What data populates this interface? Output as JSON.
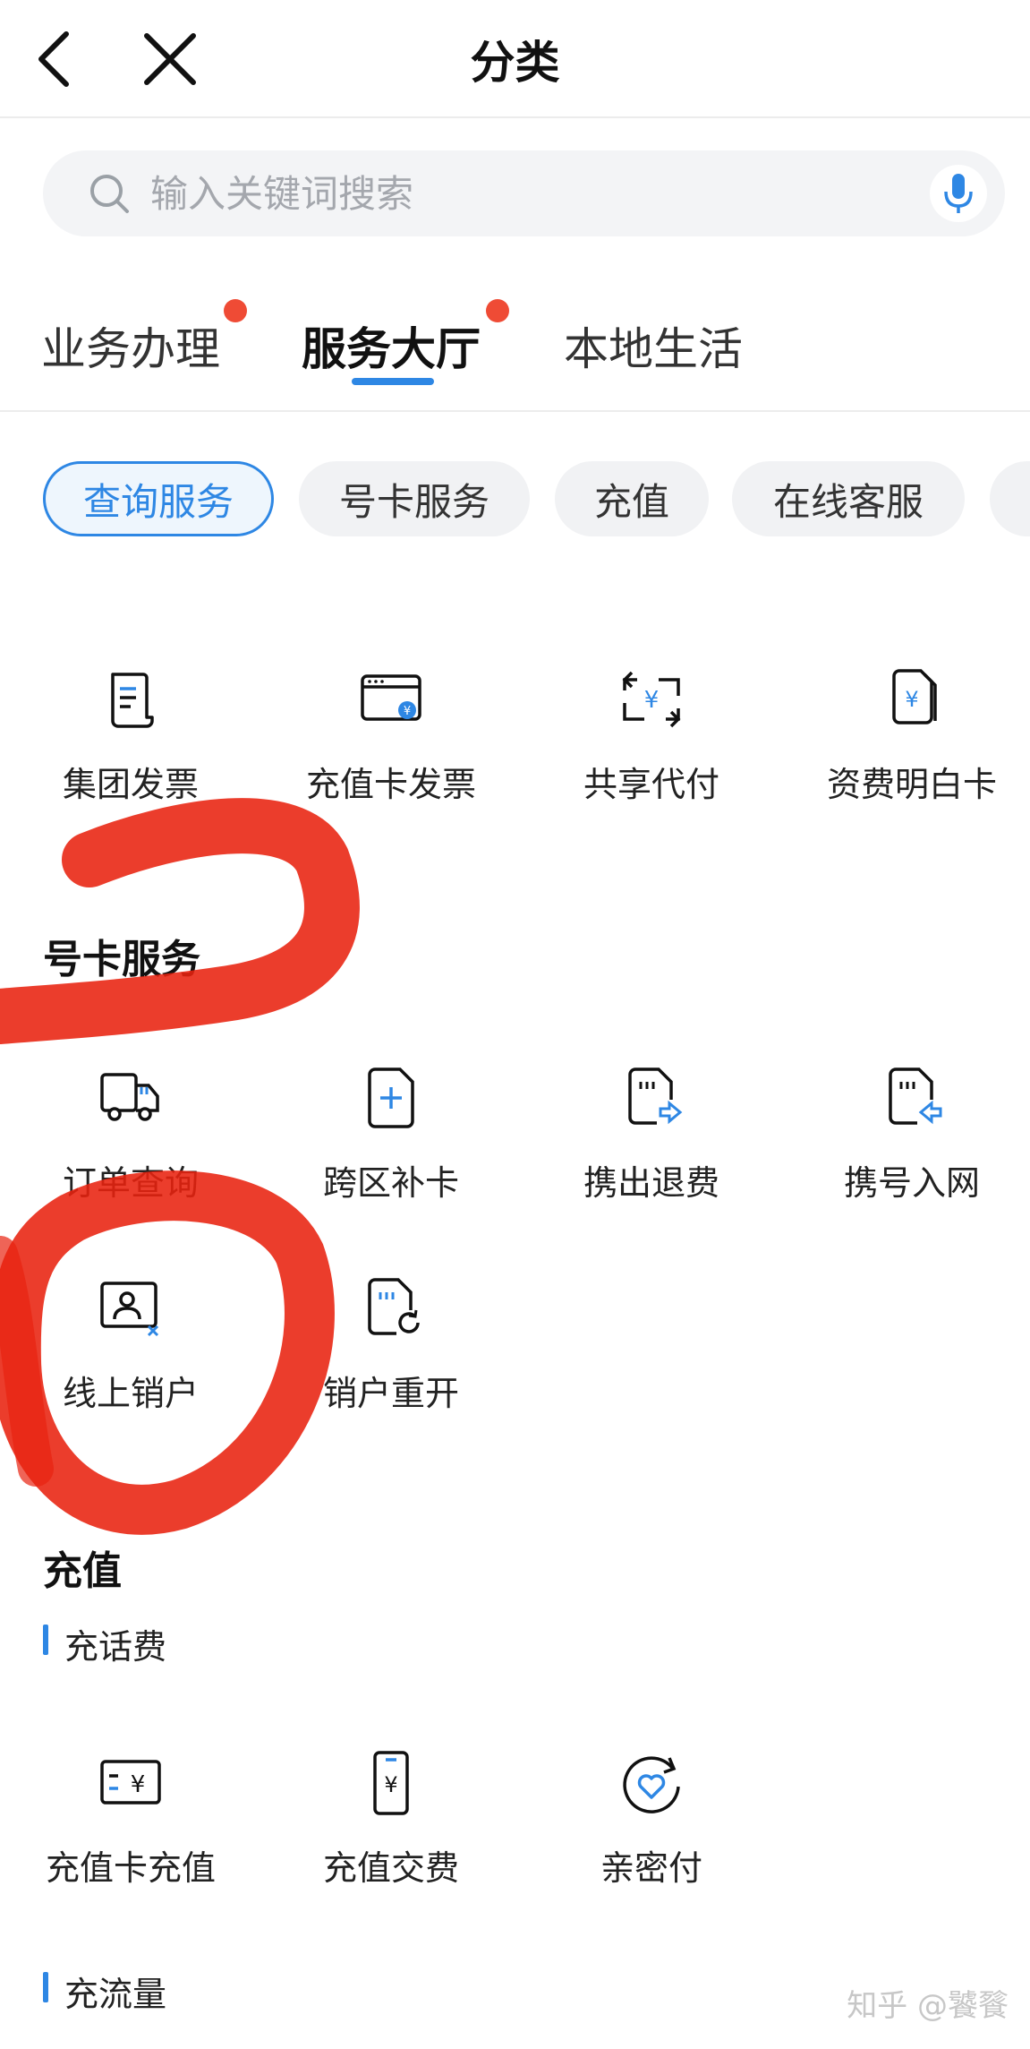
{
  "header": {
    "title": "分类",
    "back_icon": "back-arrow-icon",
    "close_icon": "close-icon"
  },
  "search": {
    "placeholder": "输入关键词搜索",
    "icon": "search-icon",
    "mic_icon": "microphone-icon"
  },
  "main_tabs": [
    {
      "label": "业务办理",
      "has_dot": true
    },
    {
      "label": "服务大厅",
      "has_dot": true,
      "active": true
    },
    {
      "label": "本地生活",
      "has_dot": false
    }
  ],
  "chips": [
    {
      "label": "查询服务",
      "active": true
    },
    {
      "label": "号卡服务"
    },
    {
      "label": "充值"
    },
    {
      "label": "在线客服"
    }
  ],
  "query_service": {
    "items": [
      {
        "label": "集团发票",
        "icon": "invoice-icon"
      },
      {
        "label": "充值卡发票",
        "icon": "card-invoice-icon"
      },
      {
        "label": "共享代付",
        "icon": "shared-pay-icon"
      },
      {
        "label": "资费明白卡",
        "icon": "tariff-card-icon"
      }
    ]
  },
  "card_service": {
    "title": "号卡服务",
    "items": [
      {
        "label": "订单查询",
        "icon": "delivery-truck-icon"
      },
      {
        "label": "跨区补卡",
        "icon": "sim-add-icon"
      },
      {
        "label": "携出退费",
        "icon": "sim-out-icon"
      },
      {
        "label": "携号入网",
        "icon": "sim-in-icon"
      },
      {
        "label": "线上销户",
        "icon": "account-cancel-icon"
      },
      {
        "label": "销户重开",
        "icon": "sim-reopen-icon"
      }
    ]
  },
  "recharge": {
    "title": "充值",
    "sub1": "充话费",
    "items": [
      {
        "label": "充值卡充值",
        "icon": "recharge-card-icon"
      },
      {
        "label": "充值交费",
        "icon": "phone-pay-icon"
      },
      {
        "label": "亲密付",
        "icon": "heart-pay-icon"
      }
    ],
    "sub2": "充流量"
  },
  "watermark": "知乎 @饕餮",
  "colors": {
    "accent": "#2e87e4",
    "dot": "#ef4b35",
    "annotation": "#e8220f"
  }
}
